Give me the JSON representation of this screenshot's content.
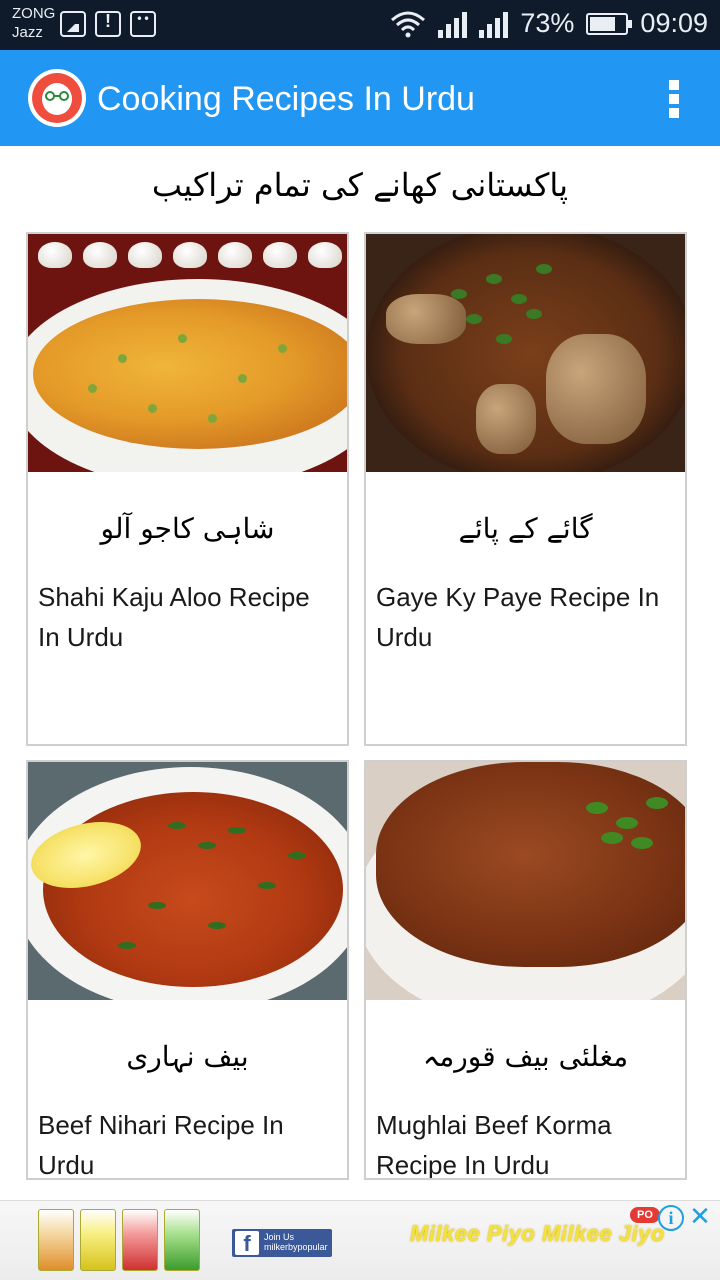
{
  "status_bar": {
    "carrier_line1": "ZONG",
    "carrier_line2": "Jazz",
    "battery_percent": "73%",
    "battery_level": 0.73,
    "time": "09:09",
    "icons": [
      "gallery-icon",
      "alert-icon",
      "face-icon",
      "wifi-icon",
      "signal-icon",
      "signal-icon",
      "battery-icon"
    ]
  },
  "app_bar": {
    "title": "Cooking Recipes In Urdu",
    "logo_icon": "chef-logo-icon",
    "menu_icon": "overflow-menu-icon",
    "color": "#2196f3"
  },
  "heading_urdu": "پاکستانی کھانے کی تمام تراکیب",
  "recipes": [
    {
      "urdu": "شاہی کاجو آلو",
      "title": "Shahi Kaju Aloo Recipe In Urdu"
    },
    {
      "urdu": "گائے کے پائے",
      "title": "Gaye Ky Paye Recipe In Urdu"
    },
    {
      "urdu": "بیف نہاری",
      "title": "Beef Nihari Recipe In Urdu"
    },
    {
      "urdu": "مغلئی بیف قورمہ",
      "title": "Mughlai Beef Korma Recipe In Urdu"
    }
  ],
  "ad": {
    "fb_text": "Join Us milkerbypopular",
    "slogan": "Milkee Piyo Milkee Jiyo",
    "brand_tag": "PO",
    "info_icon": "info-icon",
    "close_icon": "close-icon"
  }
}
